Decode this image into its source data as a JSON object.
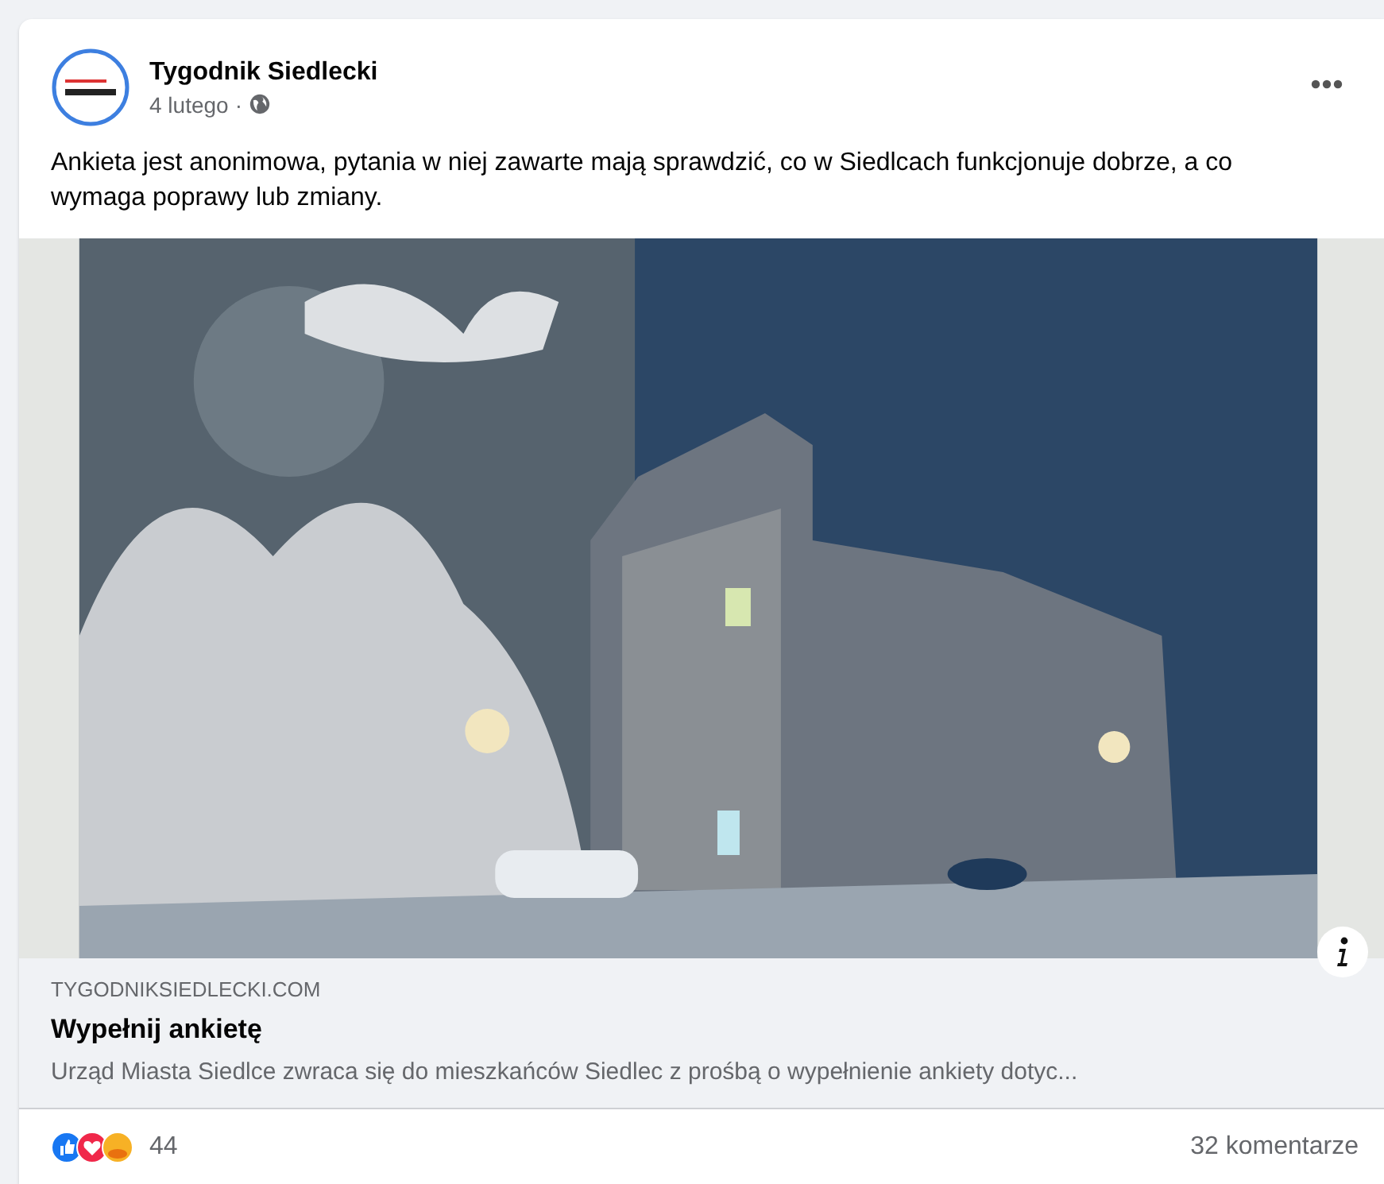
{
  "post": {
    "author": "Tygodnik Siedlecki",
    "date": "4 lutego",
    "separator": "·",
    "text": "Ankieta jest anonimowa, pytania w niej zawarte mają sprawdzić, co w Siedlcach funkcjonuje dobrze, a co wymaga poprawy lub zmiany."
  },
  "link_preview": {
    "domain": "TYGODNIKSIEDLECKI.COM",
    "title": "Wypełnij ankietę",
    "description": "Urząd Miasta Siedlce zwraca się do mieszkańców Siedlec z prośbą o wypełnienie ankiety dotyc..."
  },
  "footer": {
    "reaction_count": "44",
    "comments": "32 komentarze"
  }
}
